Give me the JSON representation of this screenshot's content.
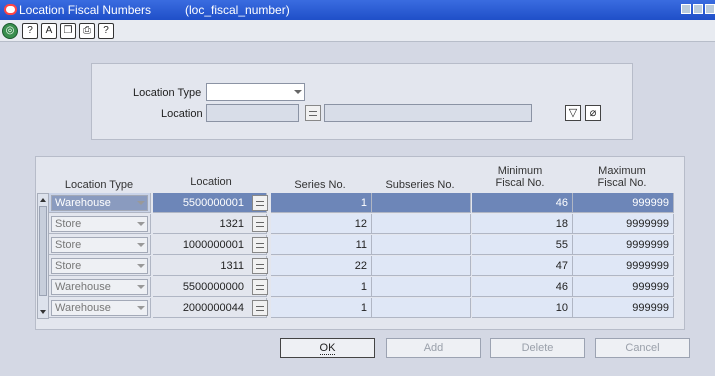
{
  "window": {
    "title": "Location Fiscal Numbers",
    "form_id": "(loc_fiscal_number)"
  },
  "toolbar": {
    "icons": [
      "globe-icon",
      "help-icon",
      "spellcheck-icon",
      "copy-icon",
      "print-icon",
      "help-icon"
    ],
    "glyphs": [
      "◎",
      "?",
      "A",
      "❐",
      "⎙",
      "?"
    ]
  },
  "filter": {
    "location_type_label": "Location Type",
    "location_type_value": "",
    "location_label": "Location",
    "location_value": "",
    "location_desc": ""
  },
  "table": {
    "headers": {
      "location_type": "Location Type",
      "location": "Location",
      "series_no": "Series No.",
      "subseries_no": "Subseries No.",
      "min_fiscal_line1": "Minimum",
      "min_fiscal_line2": "Fiscal No.",
      "max_fiscal_line1": "Maximum",
      "max_fiscal_line2": "Fiscal No."
    },
    "rows": [
      {
        "location_type": "Warehouse",
        "location": "5500000001",
        "series_no": "1",
        "subseries_no": "",
        "min_fiscal": "46",
        "max_fiscal": "999999"
      },
      {
        "location_type": "Store",
        "location": "1321",
        "series_no": "12",
        "subseries_no": "",
        "min_fiscal": "18",
        "max_fiscal": "9999999"
      },
      {
        "location_type": "Store",
        "location": "1000000001",
        "series_no": "11",
        "subseries_no": "",
        "min_fiscal": "55",
        "max_fiscal": "9999999"
      },
      {
        "location_type": "Store",
        "location": "1311",
        "series_no": "22",
        "subseries_no": "",
        "min_fiscal": "47",
        "max_fiscal": "9999999"
      },
      {
        "location_type": "Warehouse",
        "location": "5500000000",
        "series_no": "1",
        "subseries_no": "",
        "min_fiscal": "46",
        "max_fiscal": "999999"
      },
      {
        "location_type": "Warehouse",
        "location": "2000000044",
        "series_no": "1",
        "subseries_no": "",
        "min_fiscal": "10",
        "max_fiscal": "999999"
      }
    ]
  },
  "buttons": {
    "ok": "OK",
    "add": "Add",
    "delete": "Delete",
    "cancel": "Cancel"
  },
  "colors": {
    "selected_row": "#6d86b8",
    "editable_cell": "#dfe7f6",
    "titlebar": "#2a5bd7"
  }
}
